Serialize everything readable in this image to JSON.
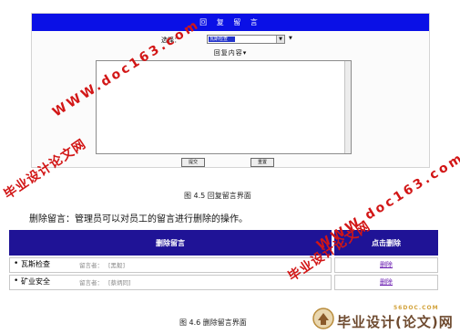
{
  "figure_45": {
    "header": "回 复 留 言",
    "select_label": "选择：",
    "select_value": "瓦斯检查",
    "content_label": "回复内容▾",
    "submit_label": "提交",
    "reset_label": "重置",
    "caption": "图 4.5 回复留言界面"
  },
  "body_text": "删除留言：管理员可以对员工的留言进行删除的操作。",
  "figure_46": {
    "header_left": "删除留言",
    "header_right": "点击删除",
    "rows": [
      {
        "topic": "瓦斯检查",
        "author_label": "留言者：",
        "author": "[黑毅]",
        "action": "删除"
      },
      {
        "topic": "矿业安全",
        "author_label": "留言者：",
        "author": "[蔡炳同]",
        "action": "删除"
      }
    ],
    "caption": "图 4.6 删除留言界面"
  },
  "watermarks": {
    "url": "WWW.doc163.com",
    "text": "毕业设计论文网"
  },
  "logo": {
    "site": "56DOC.COM",
    "text": "毕业设计(论文)网"
  },
  "colors": {
    "reply_header": "#0a10e6",
    "table_header": "#1f1396",
    "watermark": "#d21616",
    "link": "#6a1cb0"
  }
}
